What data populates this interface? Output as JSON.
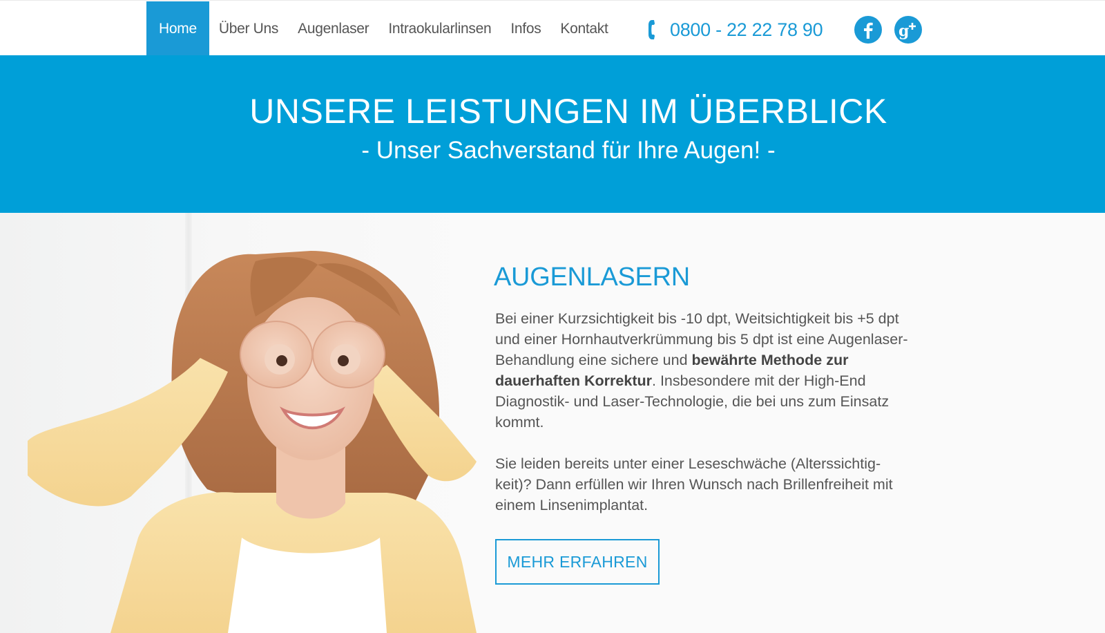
{
  "nav": {
    "items": [
      {
        "label": "Home",
        "active": true
      },
      {
        "label": "Über Uns",
        "active": false
      },
      {
        "label": "Augenlaser",
        "active": false
      },
      {
        "label": "Intraokularlinsen",
        "active": false
      },
      {
        "label": "Infos",
        "active": false
      },
      {
        "label": "Kontakt",
        "active": false
      }
    ],
    "phone": "0800 - 22 22 78 90",
    "phone_icon": "phone-icon",
    "social": [
      {
        "name": "facebook-icon"
      },
      {
        "name": "google-plus-icon"
      }
    ]
  },
  "hero": {
    "title": "UNSERE LEISTUNGEN IM ÜBERBLICK",
    "subtitle": "- Unser Sachverstand für Ihre Augen! -"
  },
  "section": {
    "title": "AUGENLASERN",
    "paragraph1": {
      "before": "Bei einer Kurzsichtigkeit bis -10 dpt, Weitsichtigkeit bis +5 dpt und einer Hornhautverkrümmung bis 5 dpt ist eine Augenlaser-Behandlung eine sichere und ",
      "bold": "bewährte Methode zur dauerhaften Korrektur",
      "after": ". Insbesondere mit der High-End Diagnostik- und Laser-Technologie, die bei uns zum Einsatz kommt."
    },
    "paragraph2": "Sie leiden bereits unter einer Leseschwäche (Alterssichtig­keit)? Dann erfüllen wir Ihren Wunsch nach Brillenfreiheit mit einem Linsenimplantat.",
    "button_label": "MEHR ERFAHREN"
  },
  "colors": {
    "brand_blue": "#1a9ad6",
    "hero_blue": "#009fd8",
    "text_gray": "#555555"
  }
}
